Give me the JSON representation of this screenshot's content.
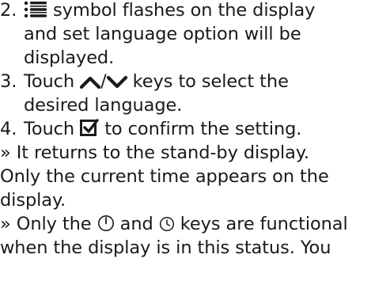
{
  "steps": [
    {
      "number": "2.",
      "icon": "list-icon",
      "line1_text": " symbol flashes on the display",
      "line2": "and set language option will be",
      "line3": "displayed."
    },
    {
      "number": "3.",
      "line1_pre": "Touch ",
      "icons": [
        "up-arrow-icon",
        "down-arrow-icon"
      ],
      "slash": "/",
      "line1_post": " keys to select the",
      "line2": "desired language."
    },
    {
      "number": "4.",
      "line1_pre": "Touch ",
      "icon": "checkbox-check-icon",
      "line1_post": " to confirm the setting."
    }
  ],
  "notes": [
    {
      "line": "» It returns to the stand-by display."
    },
    {
      "line": "Only the current time appears on the"
    },
    {
      "line": "display."
    },
    {
      "pre": "» Only the ",
      "icon1": "power-icon",
      "mid": " and ",
      "icon2": "clock-icon",
      "post": " keys are functional"
    },
    {
      "line": "when the display is in this status. You"
    }
  ]
}
